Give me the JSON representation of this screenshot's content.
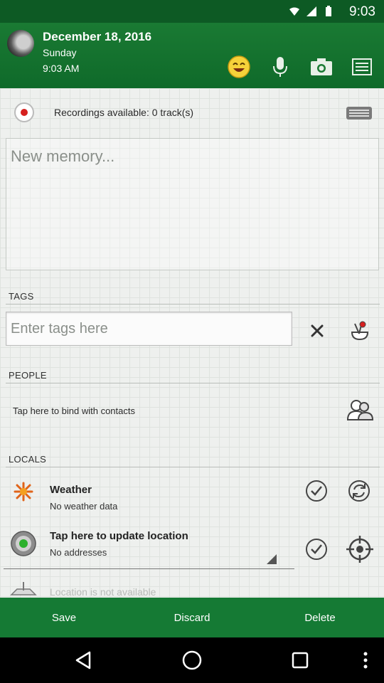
{
  "status_bar": {
    "time": "9:03"
  },
  "header": {
    "date": "December 18, 2016",
    "day": "Sunday",
    "time": "9:03 AM",
    "icons": [
      "moon-icon",
      "emoji-icon",
      "microphone-icon",
      "camera-icon",
      "menu-icon"
    ]
  },
  "recordings": {
    "label": "Recordings available: 0 track(s)"
  },
  "memory": {
    "placeholder": "New memory..."
  },
  "tags": {
    "label": "TAGS",
    "placeholder": "Enter tags here"
  },
  "people": {
    "label": "PEOPLE",
    "bind_text": "Tap here to bind with contacts"
  },
  "locals": {
    "label": "LOCALS",
    "weather": {
      "title": "Weather",
      "subtitle": "No weather data"
    },
    "location": {
      "title": "Tap here to update location",
      "subtitle": "No addresses"
    },
    "location_status": "Location is not available"
  },
  "actions": {
    "save": "Save",
    "discard": "Discard",
    "delete": "Delete"
  },
  "colors": {
    "header_green": "#1a7a33",
    "bar_green": "#157a34",
    "record_red": "#d6201f"
  }
}
